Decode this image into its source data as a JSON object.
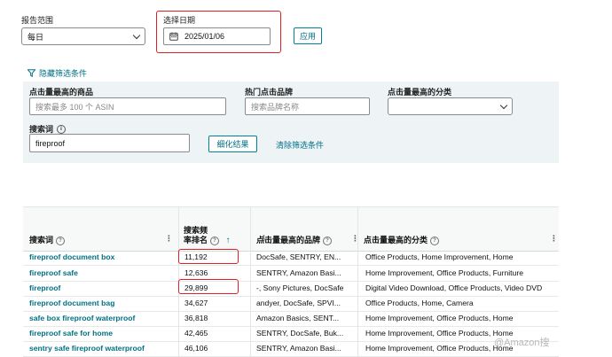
{
  "report_range": {
    "label": "报告范围",
    "value": "每日"
  },
  "date_picker": {
    "label": "选择日期",
    "value": "2025/01/06"
  },
  "apply_button": "应用",
  "filter_toggle": "隐藏筛选条件",
  "filters": {
    "top_product": {
      "label": "点击量最高的商品",
      "placeholder": "搜索最多 100 个 ASIN"
    },
    "top_brand": {
      "label": "热门点击品牌",
      "placeholder": "搜索品牌名称"
    },
    "top_category": {
      "label": "点击量最高的分类",
      "value": ""
    },
    "search_term": {
      "label": "搜索词",
      "value": "fireproof"
    },
    "refine_button": "细化结果",
    "clear_link": "清除筛选条件"
  },
  "table": {
    "columns": {
      "term": "搜索词",
      "rank_line1": "搜索频",
      "rank_line2": "率排名",
      "brand": "点击量最高的品牌",
      "category": "点击量最高的分类"
    },
    "rows": [
      {
        "term": "fireproof document box",
        "rank": "11,192",
        "brand": "DocSafe, SENTRY, EN...",
        "category": "Office Products, Home Improvement, Home"
      },
      {
        "term": "fireproof safe",
        "rank": "12,636",
        "brand": "SENTRY, Amazon Basi...",
        "category": "Home Improvement, Office Products, Furniture"
      },
      {
        "term": "fireproof",
        "rank": "29,899",
        "brand": "-, Sony Pictures, DocSafe",
        "category": "Digital Video Download, Office Products, Video DVD"
      },
      {
        "term": "fireproof document bag",
        "rank": "34,627",
        "brand": "andyer, DocSafe, SPVI...",
        "category": "Office Products, Home, Camera"
      },
      {
        "term": "safe box fireproof waterproof",
        "rank": "36,818",
        "brand": "Amazon Basics, SENT...",
        "category": "Home Improvement, Office Products, Home"
      },
      {
        "term": "fireproof safe for home",
        "rank": "42,465",
        "brand": "SENTRY, DocSafe, Buk...",
        "category": "Home Improvement, Office Products, Home"
      },
      {
        "term": "sentry safe fireproof waterproof",
        "rank": "46,106",
        "brand": "SENTRY, Amazon Basi...",
        "category": "Home Improvement, Office Products, Home"
      }
    ]
  },
  "watermark": "@Amazon搜"
}
